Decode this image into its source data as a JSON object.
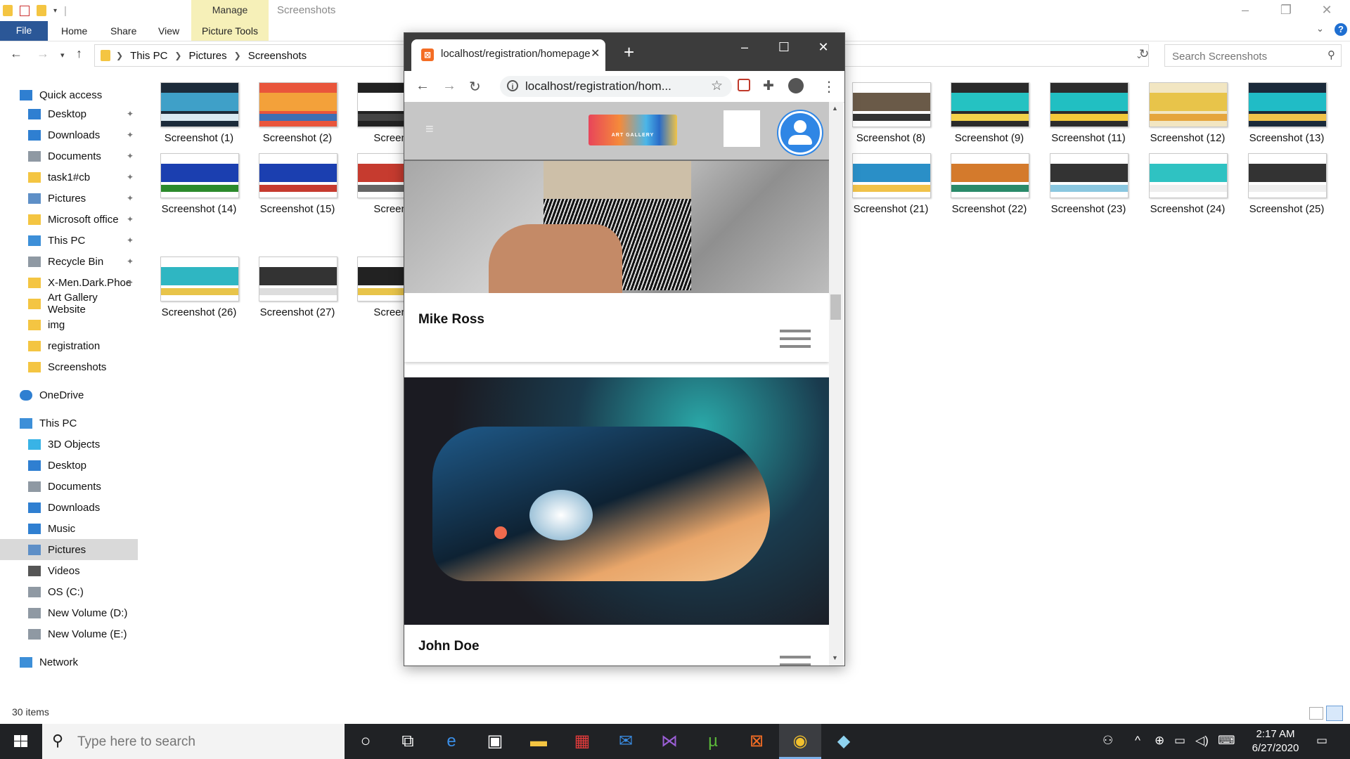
{
  "explorer": {
    "title": "Screenshots",
    "manage_tab": "Manage",
    "picture_tools": "Picture Tools",
    "ribbon_tabs": [
      "File",
      "Home",
      "Share",
      "View"
    ],
    "breadcrumb": [
      "This PC",
      "Pictures",
      "Screenshots"
    ],
    "search_placeholder": "Search Screenshots",
    "status_count": "30 items",
    "sidebar": [
      {
        "label": "Quick access",
        "icon": "star-icon",
        "pinned": false
      },
      {
        "label": "Desktop",
        "icon": "desktop-icon",
        "pinned": true
      },
      {
        "label": "Downloads",
        "icon": "download-icon",
        "pinned": true
      },
      {
        "label": "Documents",
        "icon": "document-icon",
        "pinned": true
      },
      {
        "label": "task1#cb",
        "icon": "folder-icon",
        "pinned": true
      },
      {
        "label": "Pictures",
        "icon": "pictures-icon",
        "pinned": true
      },
      {
        "label": "Microsoft office",
        "icon": "folder-icon",
        "pinned": true
      },
      {
        "label": "This PC",
        "icon": "computer-icon",
        "pinned": true
      },
      {
        "label": "Recycle Bin",
        "icon": "recycle-bin-icon",
        "pinned": true
      },
      {
        "label": "X-Men.Dark.Phoe",
        "icon": "folder-icon",
        "pinned": true
      },
      {
        "label": "Art Gallery Website",
        "icon": "folder-icon",
        "pinned": false
      },
      {
        "label": "img",
        "icon": "folder-icon",
        "pinned": false
      },
      {
        "label": "registration",
        "icon": "folder-icon",
        "pinned": false
      },
      {
        "label": "Screenshots",
        "icon": "folder-icon",
        "pinned": false
      },
      {
        "label": "OneDrive",
        "icon": "cloud-icon",
        "pinned": false
      },
      {
        "label": "This PC",
        "icon": "computer-icon",
        "pinned": false
      },
      {
        "label": "3D Objects",
        "icon": "cube-icon",
        "pinned": false
      },
      {
        "label": "Desktop",
        "icon": "desktop-icon",
        "pinned": false
      },
      {
        "label": "Documents",
        "icon": "document-icon",
        "pinned": false
      },
      {
        "label": "Downloads",
        "icon": "download-icon",
        "pinned": false
      },
      {
        "label": "Music",
        "icon": "music-icon",
        "pinned": false
      },
      {
        "label": "Pictures",
        "icon": "pictures-icon",
        "pinned": false,
        "selected": true
      },
      {
        "label": "Videos",
        "icon": "video-icon",
        "pinned": false
      },
      {
        "label": "OS (C:)",
        "icon": "drive-icon",
        "pinned": false
      },
      {
        "label": "New Volume (D:)",
        "icon": "drive-icon",
        "pinned": false
      },
      {
        "label": "New Volume (E:)",
        "icon": "drive-icon",
        "pinned": false
      },
      {
        "label": "Network",
        "icon": "network-icon",
        "pinned": false
      }
    ],
    "files": [
      "Screenshot (1)",
      "Screenshot (2)",
      "Screensh",
      "Screenshot (8)",
      "Screenshot (9)",
      "Screenshot (11)",
      "Screenshot (12)",
      "Screenshot (13)",
      "Screenshot (14)",
      "Screenshot (15)",
      "Screensh",
      "Screenshot (21)",
      "Screenshot (22)",
      "Screenshot (23)",
      "Screenshot (24)",
      "Screenshot (25)",
      "Screenshot (26)",
      "Screenshot (27)",
      "Screensh"
    ]
  },
  "browser": {
    "tab_title": "localhost/registration/homepage",
    "url": "localhost/registration/hom...",
    "logo_text": "ART GALLERY",
    "cards": [
      {
        "name": "Mike Ross"
      },
      {
        "name": "John Doe"
      }
    ]
  },
  "taskbar": {
    "search_placeholder": "Type here to search",
    "time": "2:17 AM",
    "date": "6/27/2020",
    "apps": [
      "task-view-icon",
      "edge-icon",
      "store-icon",
      "file-explorer-icon",
      "gift-icon",
      "mail-icon",
      "visual-studio-icon",
      "utorrent-icon",
      "xampp-icon",
      "chrome-icon",
      "app-icon"
    ]
  }
}
